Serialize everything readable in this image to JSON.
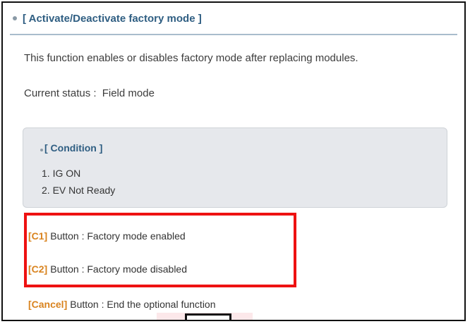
{
  "header": {
    "title": "[ Activate/Deactivate factory mode ]"
  },
  "description": "This function enables or disables factory mode after replacing modules.",
  "status": {
    "label": "Current status :",
    "value": "Field mode"
  },
  "condition": {
    "title": "[ Condition ]",
    "items": [
      "1. IG ON",
      "2. EV Not Ready"
    ]
  },
  "buttons": {
    "c1": {
      "tag": "[C1]",
      "text": "Button : Factory mode enabled"
    },
    "c2": {
      "tag": "[C2]",
      "text": "Button : Factory mode disabled"
    },
    "cancel": {
      "tag": "[Cancel]",
      "text": "Button : End the optional function"
    }
  },
  "colors": {
    "title_blue": "#2f5e82",
    "tag_orange": "#d9831e",
    "highlight_red": "#ee1111",
    "condition_bg": "#e6e8ec"
  }
}
